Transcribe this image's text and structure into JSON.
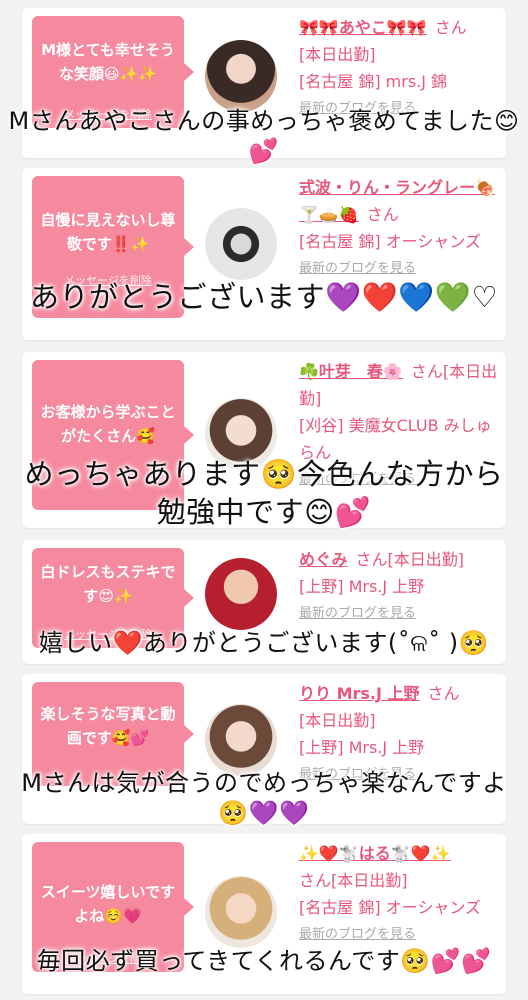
{
  "entries": [
    {
      "message": "M様とても幸せそうな笑顔😃✨✨",
      "delete_label": "メッセージを削除",
      "name": "🎀🎀あやこ🎀🎀",
      "suffix": "さん",
      "status": "[本日出勤]",
      "shop": "[名古屋 錦] mrs.J 錦",
      "blog": "最新のブログを見る",
      "caption": "Mさんあやこさんの事めっちゃ褒めてました😊💕"
    },
    {
      "message": "自慢に見えないし尊敬です‼️✨",
      "delete_label": "メッセージを削除",
      "name": "式波・りん・ラングレー🍖🍸🥧🍓",
      "suffix": "さん",
      "status": "",
      "shop": "[名古屋 錦] オーシャンズ",
      "blog": "最新のブログを見る",
      "caption": "ありがとうございます💜❤️💙💚♡"
    },
    {
      "message": "お客様から学ぶことがたくさん🥰",
      "delete_label": "",
      "name": "☘️叶芽　春🌸",
      "suffix": "さん[本日出勤]",
      "status": "",
      "shop": "[刈谷] 美魔女CLUB みしゅらん",
      "blog": "最新のブログを見る",
      "caption": "めっちゃあります🥺今色んな方から勉強中です😊💕"
    },
    {
      "message": "白ドレスもステキです😍✨",
      "delete_label": "メッセージを削除",
      "name": "めぐみ",
      "suffix": "さん[本日出勤]",
      "status": "",
      "shop": "[上野] Mrs.J 上野",
      "blog": "最新のブログを見る",
      "caption": "嬉しい❤️ありがとうございます(˚ଳ˚ )🥺"
    },
    {
      "message": "楽しそうな写真と動画です🥰💕",
      "delete_label": "",
      "name": "りり Mrs.J 上野",
      "suffix": "さん",
      "status": "[本日出勤]",
      "shop": "[上野] Mrs.J 上野",
      "blog": "最新のブログを見る",
      "caption": "Mさんは気が合うのでめっちゃ楽なんですよ🥺💜💜"
    },
    {
      "message": "スイーツ嬉しいですよね☺️💗",
      "delete_label": "メッセージを削除",
      "name": "✨❤️🐩はる🐩❤️✨",
      "suffix": "",
      "status": "さん[本日出勤]",
      "shop": "[名古屋 錦] オーシャンズ",
      "blog": "最新のブログを見る",
      "caption": "毎回必ず買ってきてくれるんです🥺💕💕"
    }
  ],
  "colors": {
    "bubble": "#f58a9f",
    "name": "#e8577c",
    "background": "#f2f2f2"
  }
}
